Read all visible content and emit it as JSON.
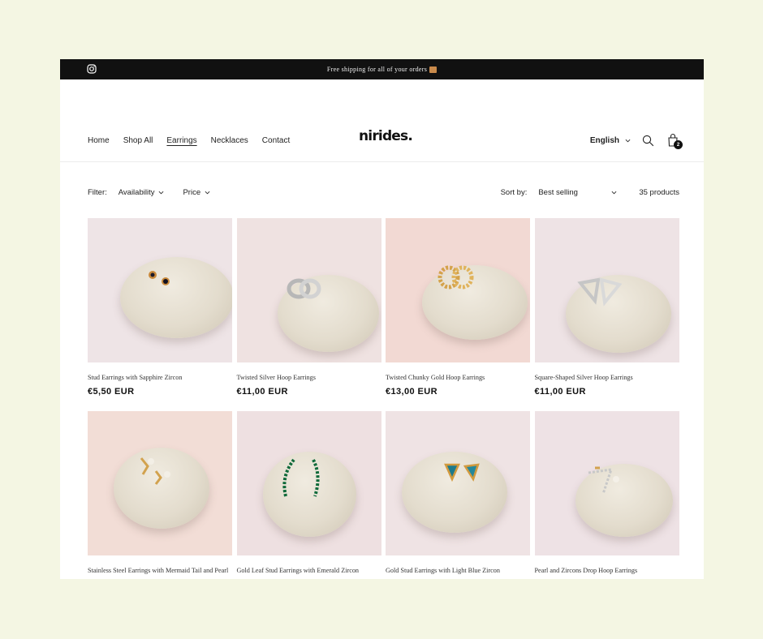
{
  "announcement": {
    "text": "Free shipping for all of your orders"
  },
  "nav": {
    "items": [
      "Home",
      "Shop All",
      "Earrings",
      "Necklaces",
      "Contact"
    ],
    "active": "Earrings"
  },
  "brand": {
    "logo": "nirides."
  },
  "header": {
    "language": "English",
    "cart_count": "2"
  },
  "toolbar": {
    "filter_label": "Filter:",
    "availability": "Availability",
    "price": "Price",
    "sort_label": "Sort by:",
    "sort_value": "Best selling",
    "product_count": "35 products"
  },
  "products": [
    {
      "title": "Stud Earrings with Sapphire Zircon",
      "price": "€5,50 EUR",
      "bg": "#eee4e6",
      "jewel": "stud-sapphire"
    },
    {
      "title": "Twisted Silver Hoop Earrings",
      "price": "€11,00 EUR",
      "bg": "#efe2e1",
      "jewel": "silver-hoop"
    },
    {
      "title": "Twisted Chunky Gold Hoop Earrings",
      "price": "€13,00 EUR",
      "bg": "#f2d9d3",
      "jewel": "gold-hoop"
    },
    {
      "title": "Square-Shaped Silver Hoop Earrings",
      "price": "€11,00 EUR",
      "bg": "#eee3e5",
      "jewel": "square-silver"
    },
    {
      "title": "Stainless Steel Earrings with Mermaid Tail and Pearl",
      "price": "",
      "bg": "#f2ddd6",
      "jewel": "mermaid"
    },
    {
      "title": "Gold Leaf Stud Earrings with Emerald Zircon",
      "price": "",
      "bg": "#eee0e1",
      "jewel": "emerald-leaf"
    },
    {
      "title": "Gold Stud Earrings with Light Blue Zircon",
      "price": "",
      "bg": "#efe3e4",
      "jewel": "blue-triangle"
    },
    {
      "title": "Pearl and Zircons Drop Hoop Earrings",
      "price": "",
      "bg": "#eee2e5",
      "jewel": "pearl-drop"
    }
  ],
  "colors": {
    "background": "#f4f6e3",
    "announcement_bar": "#111111",
    "text": "#1a1a1a"
  }
}
